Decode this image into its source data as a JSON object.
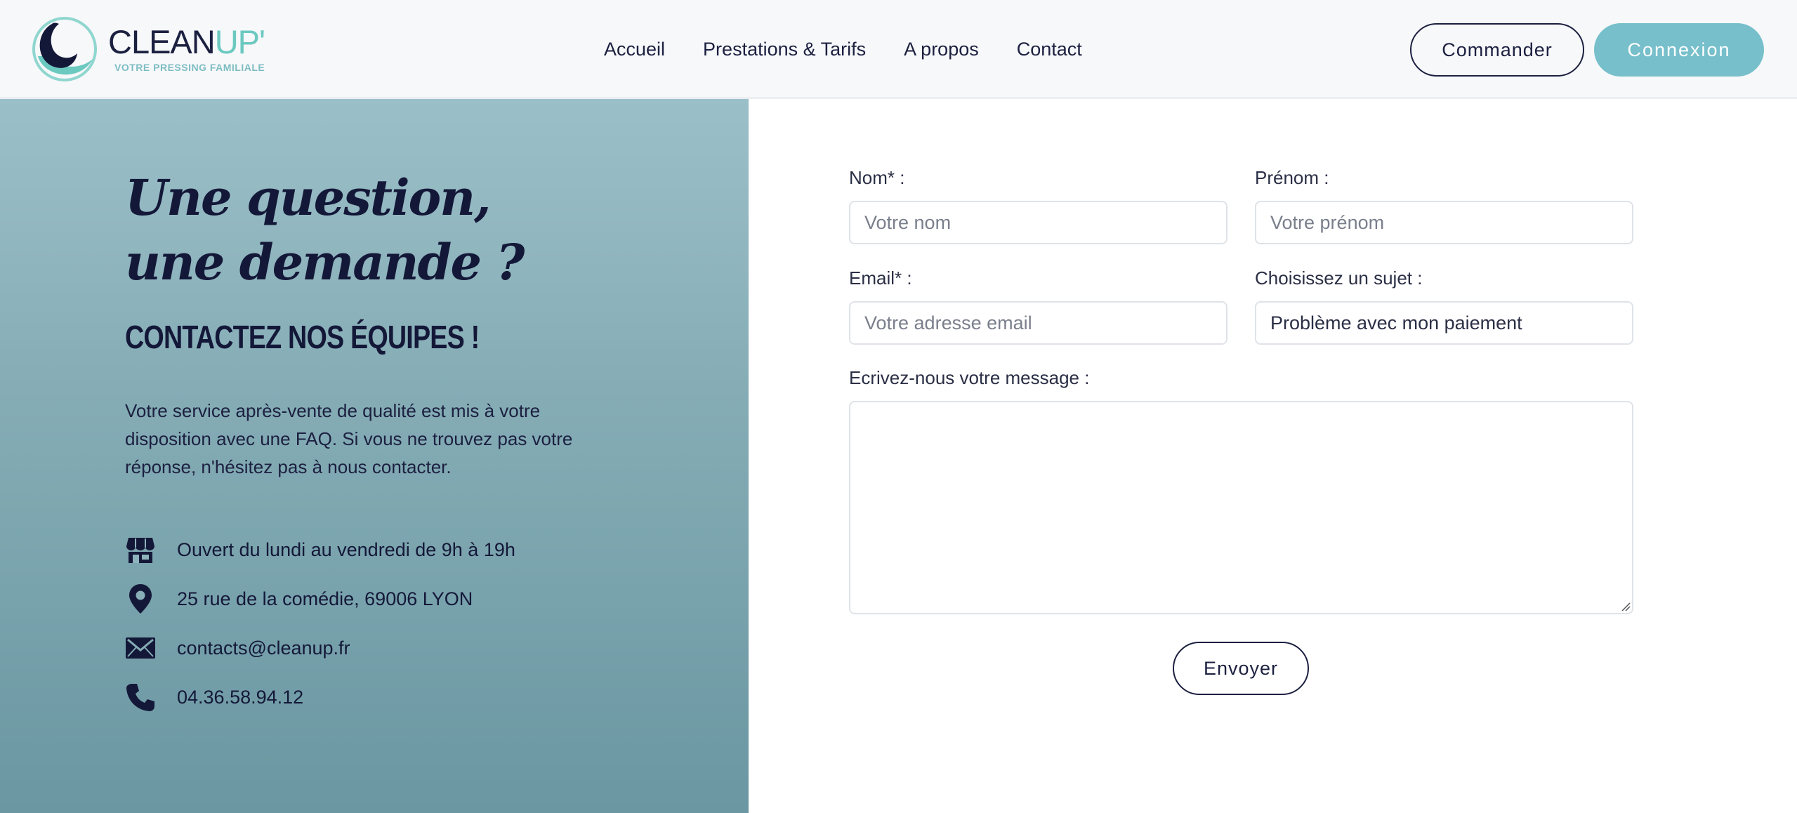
{
  "brand": {
    "name_part1": "CLEAN",
    "name_part2": "UP'",
    "tagline": "VOTRE PRESSING FAMILIALE",
    "colors": {
      "navy": "#1c2040",
      "teal": "#6cc9c0",
      "light_blue": "#76bfcb"
    }
  },
  "nav": {
    "items": [
      {
        "label": "Accueil"
      },
      {
        "label": "Prestations & Tarifs"
      },
      {
        "label": "A propos"
      },
      {
        "label": "Contact"
      }
    ]
  },
  "header_actions": {
    "order_label": "Commander",
    "login_label": "Connexion"
  },
  "contact_info": {
    "heading": "Une question, une demande ?",
    "subheading": "CONTACTEZ NOS ÉQUIPES !",
    "intro": "Votre service après-vente de qualité est mis à votre disposition avec une FAQ. Si vous ne trouvez pas votre réponse, n'hésitez pas à nous contacter.",
    "items": [
      {
        "icon": "store-icon",
        "text": "Ouvert du lundi au vendredi de 9h à 19h"
      },
      {
        "icon": "location-pin-icon",
        "text": "25 rue de la comédie, 69006 LYON"
      },
      {
        "icon": "envelope-icon",
        "text": "contacts@cleanup.fr"
      },
      {
        "icon": "phone-icon",
        "text": "04.36.58.94.12"
      }
    ]
  },
  "form": {
    "name_label": "Nom* :",
    "name_placeholder": "Votre nom",
    "firstname_label": "Prénom :",
    "firstname_placeholder": "Votre prénom",
    "email_label": "Email* :",
    "email_placeholder": "Votre adresse email",
    "subject_label": "Choisissez un sujet :",
    "subject_value": "Problème avec mon paiement",
    "message_label": "Ecrivez-nous votre message :",
    "message_value": "",
    "submit_label": "Envoyer"
  }
}
